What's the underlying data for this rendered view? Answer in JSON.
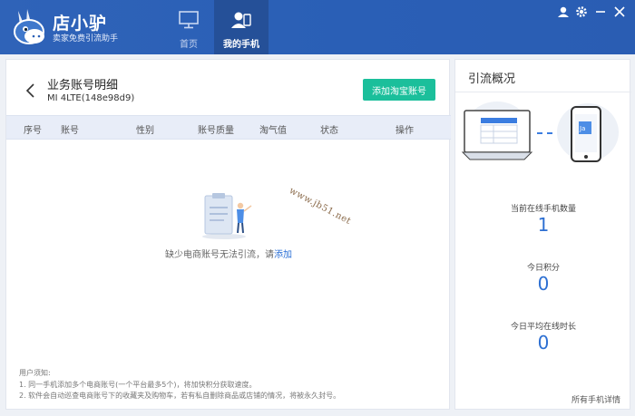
{
  "app": {
    "name": "店小驴",
    "slogan": "卖家免费引流助手"
  },
  "nav": {
    "home_label": "首页",
    "phones_label": "我的手机"
  },
  "window_controls": [
    "user-icon",
    "gear-icon",
    "minimize-icon",
    "close-icon"
  ],
  "main": {
    "title": "业务账号明细",
    "device": "MI 4LTE(148e98d9)",
    "add_button": "添加淘宝账号",
    "columns": [
      "序号",
      "账号",
      "性别",
      "账号质量",
      "淘气值",
      "状态",
      "操作"
    ],
    "empty_text": "缺少电商账号无法引流，请",
    "empty_link": "添加",
    "notes_title": "用户须知:",
    "notes": [
      "1. 同一手机添加多个电商账号(一个平台最多5个)，将加快积分获取速度。",
      "2. 软件会自动巡查电商账号下的收藏夹及购物车，若有私自删除商品或店铺的情况，将被永久封号。"
    ]
  },
  "side": {
    "title": "引流概况",
    "stats": [
      {
        "label": "当前在线手机数量",
        "value": "1"
      },
      {
        "label": "今日积分",
        "value": "0"
      },
      {
        "label": "今日平均在线时长",
        "value": "0"
      }
    ],
    "detail_link": "所有手机详情"
  },
  "watermark": "www.jb51.net",
  "colors": {
    "header": "#2a5fb6",
    "accent_button": "#1bbf9b",
    "stat_value": "#2d6fd2",
    "link": "#2a6fd6"
  }
}
